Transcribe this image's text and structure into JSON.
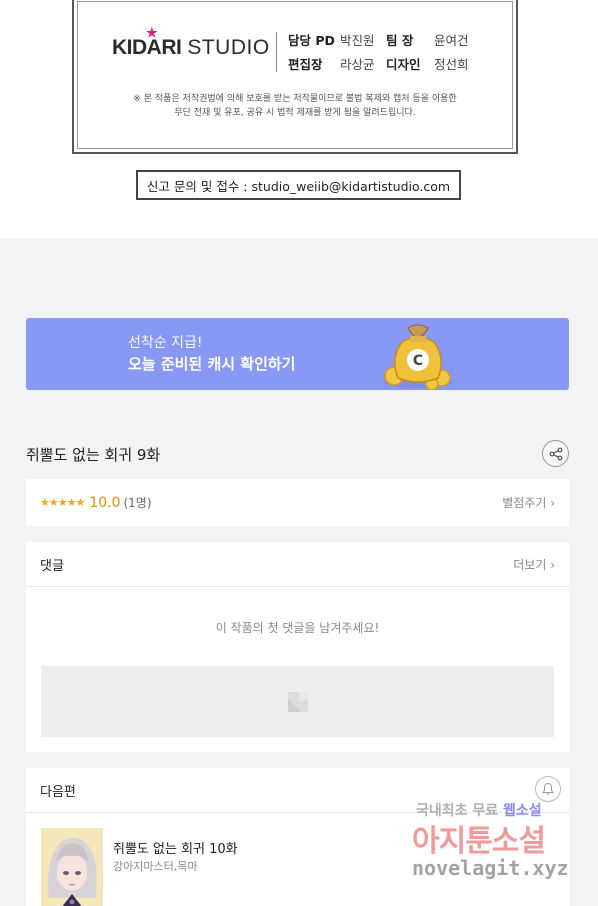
{
  "credits": {
    "logo_brand": "KIDARI",
    "logo_studio": "STUDIO",
    "staff": [
      {
        "role": "담당 PD",
        "name": "박진원"
      },
      {
        "role": "팀 장",
        "name": "윤여건"
      },
      {
        "role": "편집장",
        "name": "라상균"
      },
      {
        "role": "디자인",
        "name": "정선희"
      }
    ],
    "copyright_line1": "※ 본 작품은 저작권법에 의해 보호를 받는 저작물이므로 불법 복제와 캡처 등을 이용한",
    "copyright_line2": "무단 전재 및 유포, 공유 시 법적 제재를 받게 됨을 알려드립니다.",
    "report_contact": "신고 문의 및 접수 : studio_weiib@kidartistudio.com"
  },
  "banner": {
    "subtitle": "선착순 지급!",
    "title": "오늘 준비된 캐시 확인하기",
    "bg_color": "#8898f5"
  },
  "episode": {
    "title": "쥐뿔도 없는 회귀 9화",
    "share_icon": "share-icon"
  },
  "rating": {
    "stars": "★★★★★",
    "score": "10.0",
    "count": "(1명)",
    "rate_label": "별점주기 ›"
  },
  "comments": {
    "title": "댓글",
    "more_label": "더보기 ›",
    "empty_message": "이 작품의 첫 댓글을 남겨주세요!"
  },
  "next_episode": {
    "section_title": "다음편",
    "title": "쥐뿔도 없는 회귀 10화",
    "author": "강아지마스터,목마"
  },
  "watermark": {
    "line1_a": "국내최초 무료",
    "line1_b": "웹소설",
    "line2": "아지툰소설",
    "line3": "novelagit.xyz"
  }
}
